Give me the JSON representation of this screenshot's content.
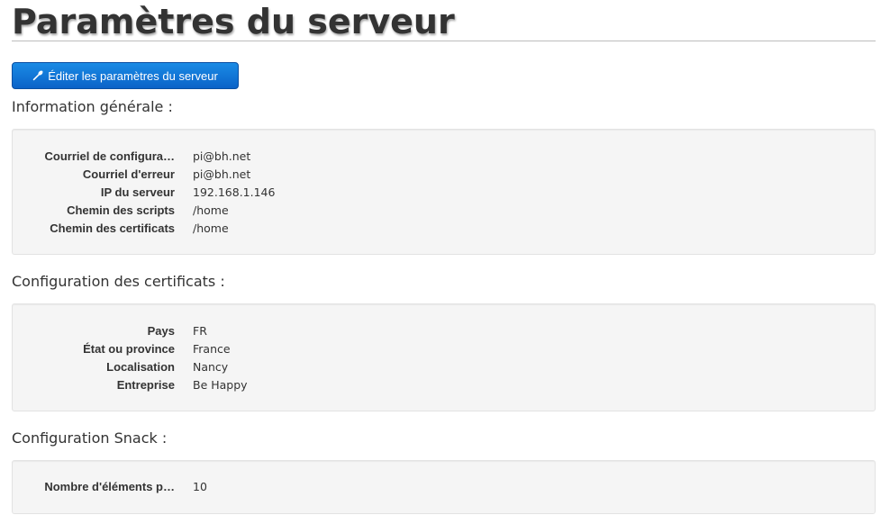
{
  "header": {
    "title": "Paramètres du serveur"
  },
  "toolbar": {
    "edit_label": "Éditer les paramètres du serveur",
    "edit_icon": "wrench-icon"
  },
  "sections": {
    "general": {
      "heading": "Information générale :",
      "rows": [
        {
          "label": "Courriel de configura…",
          "value": "pi@bh.net"
        },
        {
          "label": "Courriel d'erreur",
          "value": "pi@bh.net"
        },
        {
          "label": "IP du serveur",
          "value": "192.168.1.146"
        },
        {
          "label": "Chemin des scripts",
          "value": "/home"
        },
        {
          "label": "Chemin des certificats",
          "value": "/home"
        }
      ]
    },
    "certificates": {
      "heading": "Configuration des certificats :",
      "rows": [
        {
          "label": "Pays",
          "value": "FR"
        },
        {
          "label": "État ou province",
          "value": "France"
        },
        {
          "label": "Localisation",
          "value": "Nancy"
        },
        {
          "label": "Entreprise",
          "value": "Be Happy"
        }
      ]
    },
    "snack": {
      "heading": "Configuration Snack :",
      "rows": [
        {
          "label": "Nombre d'éléments p…",
          "value": "10"
        }
      ]
    }
  },
  "colors": {
    "primary_button": "#0b63c8",
    "well_background": "#f5f5f5",
    "text": "#333333"
  }
}
